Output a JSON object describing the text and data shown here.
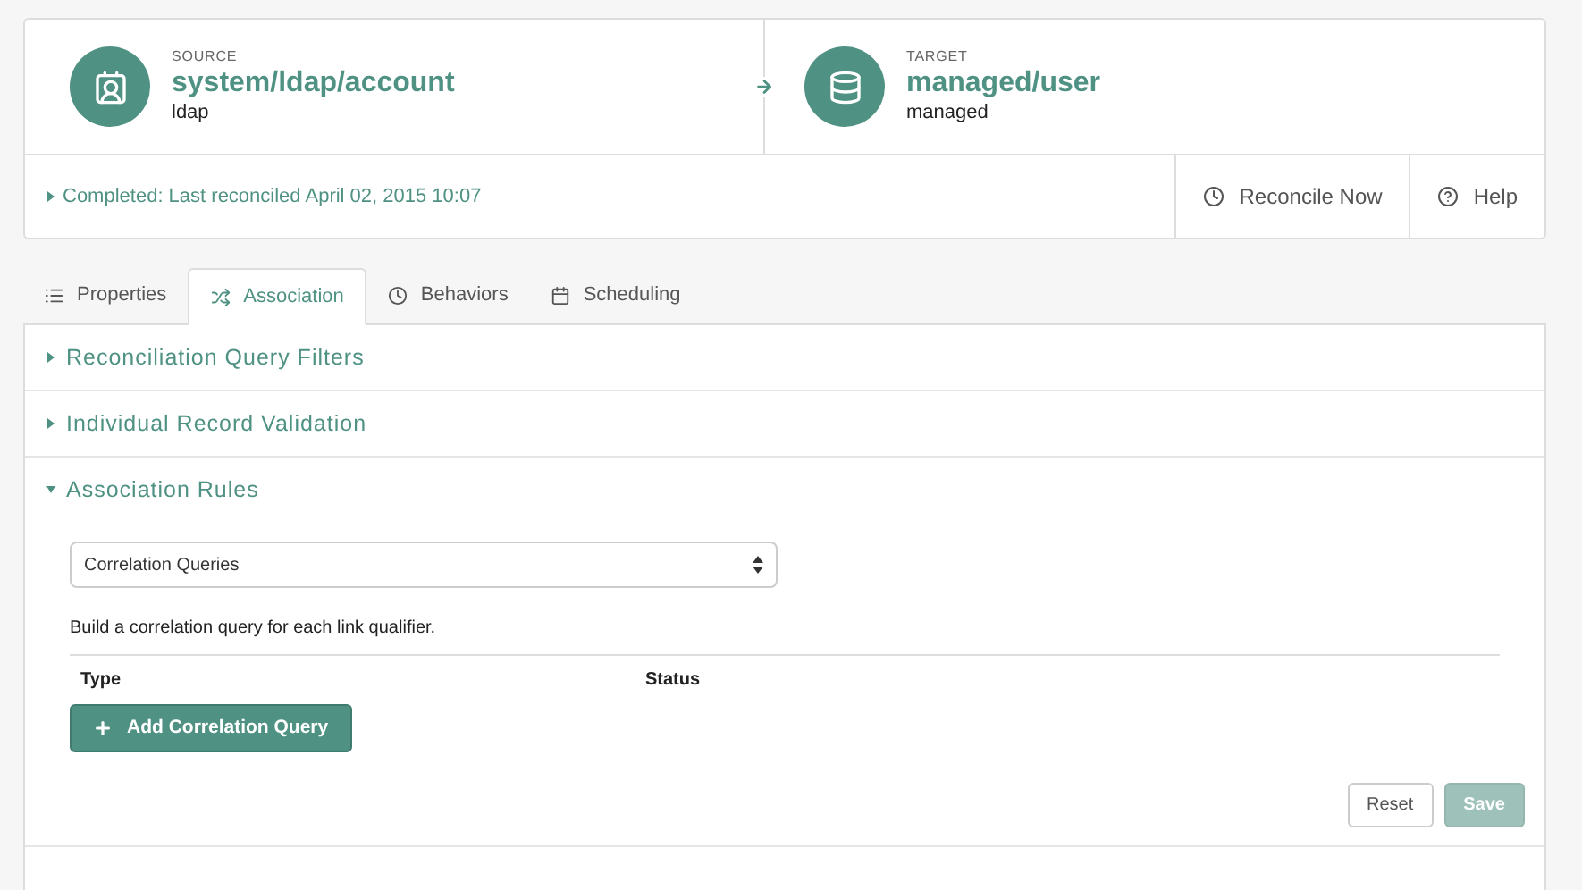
{
  "source": {
    "caption": "SOURCE",
    "name": "system/ldap/account",
    "sub": "ldap"
  },
  "target": {
    "caption": "TARGET",
    "name": "managed/user",
    "sub": "managed"
  },
  "status": {
    "text": "Completed: Last reconciled April 02, 2015 10:07",
    "expanded": false
  },
  "actions": [
    {
      "kind": "clock",
      "label": "Reconcile Now"
    },
    {
      "kind": "help",
      "label": "Help"
    }
  ],
  "tabs": [
    {
      "kind": "list",
      "label": "Properties",
      "selected": false
    },
    {
      "kind": "shuffle",
      "label": "Association",
      "selected": true
    },
    {
      "kind": "clock",
      "label": "Behaviors",
      "selected": false
    },
    {
      "kind": "calendar",
      "label": "Scheduling",
      "selected": false
    }
  ],
  "sections": [
    {
      "title": "Reconciliation Query Filters",
      "expanded": false
    },
    {
      "title": "Individual Record Validation",
      "expanded": false
    },
    {
      "title": "Association Rules",
      "expanded": true
    }
  ],
  "association": {
    "select_value": "Correlation Queries",
    "hint": "Build a correlation query for each link qualifier.",
    "columns": [
      "Type",
      "Status"
    ],
    "add_button": "Add Correlation Query"
  },
  "footer_buttons": [
    {
      "label": "Reset",
      "disabled": false,
      "primary": false
    },
    {
      "label": "Save",
      "disabled": true,
      "primary": true
    }
  ]
}
